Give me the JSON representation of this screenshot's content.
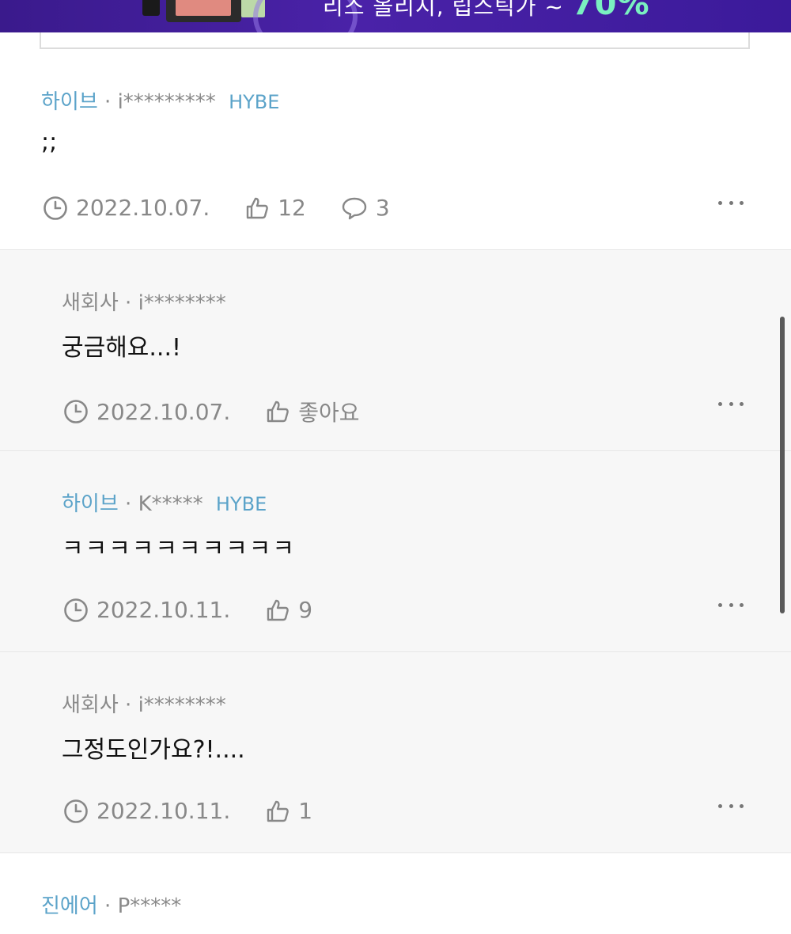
{
  "banner": {
    "text": "리스 올리시, 립스틱가 ~",
    "upto": "~",
    "percent": "70%"
  },
  "comments": [
    {
      "company": "하이브",
      "sep": "·",
      "user": "i*********",
      "badge": "HYBE",
      "text": ";;",
      "date": "2022.10.07.",
      "likes": "12",
      "replies": "3"
    },
    {
      "company": "새회사",
      "sep": "·",
      "user": "i********",
      "text": "궁금해요...!",
      "date": "2022.10.07.",
      "likes": "좋아요"
    },
    {
      "company": "하이브",
      "sep": "·",
      "user": "K*****",
      "badge": "HYBE",
      "text": "ㅋㅋㅋㅋㅋㅋㅋㅋㅋㅋ",
      "date": "2022.10.11.",
      "likes": "9"
    },
    {
      "company": "새회사",
      "sep": "·",
      "user": "i********",
      "text": "그정도인가요?!....",
      "date": "2022.10.11.",
      "likes": "1"
    },
    {
      "company": "진에어",
      "sep": "·",
      "user": "P*****"
    }
  ]
}
